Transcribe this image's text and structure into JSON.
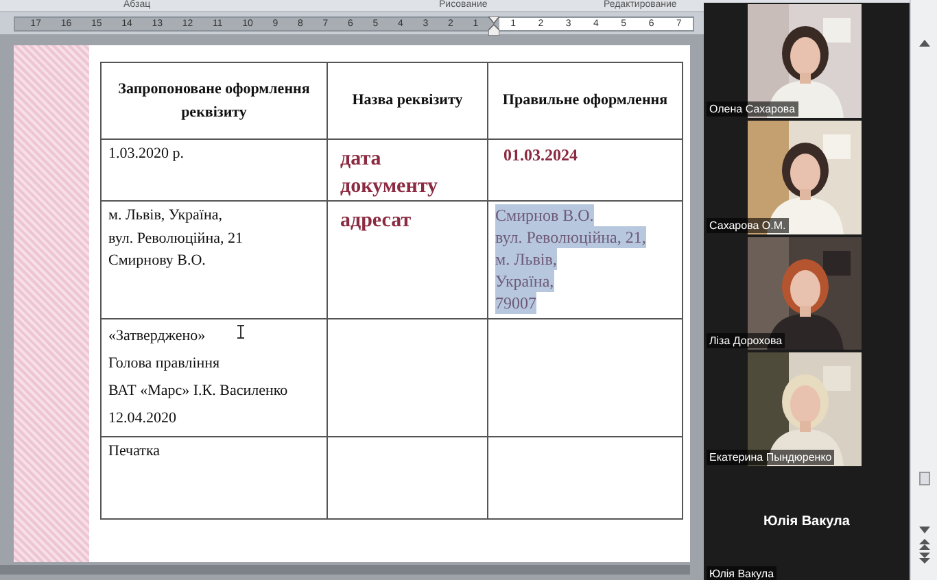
{
  "ribbon_groups": [
    "Абзац",
    "Рисование",
    "Редактирование"
  ],
  "ruler": {
    "left_ticks": [
      "17",
      "16",
      "15",
      "14",
      "13",
      "12",
      "11",
      "10",
      "9",
      "8",
      "7",
      "6",
      "5",
      "4",
      "3",
      "2",
      "1"
    ],
    "right_ticks": [
      "1",
      "2",
      "3",
      "4",
      "5",
      "6",
      "7"
    ]
  },
  "table": {
    "columns": [
      "Запропоноване оформлення реквізиту",
      "Назва реквізиту",
      "Правильне оформлення"
    ],
    "rows": [
      [
        {
          "kind": "plain",
          "lines": [
            "1.03.2020 р."
          ]
        },
        {
          "kind": "label",
          "lines": [
            "дата",
            "документу"
          ]
        },
        {
          "kind": "answer",
          "lines": [
            "01.03.2024"
          ]
        }
      ],
      [
        {
          "kind": "plain",
          "lines": [
            "м.  Львів,  Україна,",
            "вул. Революційна, 21",
            "Смирнову  В.О."
          ]
        },
        {
          "kind": "label",
          "lines": [
            "адресат"
          ]
        },
        {
          "kind": "selection",
          "lines": [
            "Смирнов В.О.",
            "вул. Революційна, 21,",
            "м.  Львів,",
            "Україна,",
            "79007"
          ]
        }
      ],
      [
        {
          "kind": "paragraphs",
          "lines": [
            "«Затверджено»",
            "Голова правління",
            "ВАТ  «Марс» І.К.  Василенко",
            "12.04.2020"
          ]
        },
        {
          "kind": "empty"
        },
        {
          "kind": "empty"
        }
      ],
      [
        {
          "kind": "plain",
          "lines": [
            "Печатка"
          ]
        },
        {
          "kind": "empty"
        },
        {
          "kind": "empty"
        }
      ]
    ]
  },
  "participants": [
    {
      "name": "Олена Сахарова",
      "video": true
    },
    {
      "name": "Сахарова О.М.",
      "video": true
    },
    {
      "name": "Ліза Дорохова",
      "video": true
    },
    {
      "name": "Екатерина Пындюренко",
      "video": true
    },
    {
      "name": "Юлія Вакула",
      "video": false,
      "caption": "Юлія Вакула"
    }
  ]
}
